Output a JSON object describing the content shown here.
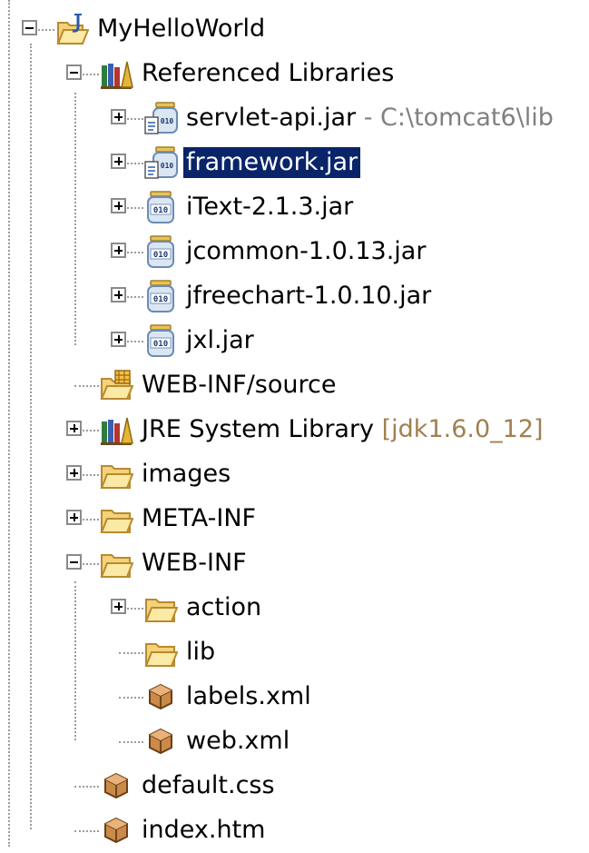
{
  "tree": {
    "items": [
      {
        "id": "project",
        "label": "MyHelloWorld",
        "icon": "java-project-icon",
        "depth": 0,
        "toggle": "minus"
      },
      {
        "id": "ref-libs",
        "label": "Referenced Libraries",
        "icon": "library-icon",
        "depth": 1,
        "toggle": "minus"
      },
      {
        "id": "servlet-api",
        "label": "servlet-api.jar",
        "decoration": " - C:\\tomcat6\\lib",
        "icon": "jar-source-icon",
        "depth": 2,
        "toggle": "plus"
      },
      {
        "id": "framework",
        "label": "framework.jar",
        "icon": "jar-source-icon",
        "depth": 2,
        "toggle": "plus",
        "selected": true
      },
      {
        "id": "itext",
        "label": "iText-2.1.3.jar",
        "icon": "jar-icon",
        "depth": 2,
        "toggle": "plus"
      },
      {
        "id": "jcommon",
        "label": "jcommon-1.0.13.jar",
        "icon": "jar-icon",
        "depth": 2,
        "toggle": "plus"
      },
      {
        "id": "jfreechart",
        "label": "jfreechart-1.0.10.jar",
        "icon": "jar-icon",
        "depth": 2,
        "toggle": "plus"
      },
      {
        "id": "jxl",
        "label": "jxl.jar",
        "icon": "jar-icon",
        "depth": 2,
        "toggle": "plus"
      },
      {
        "id": "webinf-source",
        "label": "WEB-INF/source",
        "icon": "source-folder-icon",
        "depth": 1,
        "toggle": "none"
      },
      {
        "id": "jre",
        "label": "JRE System Library",
        "decoration": " [jdk1.6.0_12]",
        "icon": "library-icon",
        "depth": 1,
        "toggle": "plus"
      },
      {
        "id": "images",
        "label": "images",
        "icon": "folder-icon",
        "depth": 1,
        "toggle": "plus"
      },
      {
        "id": "meta-inf",
        "label": "META-INF",
        "icon": "folder-icon",
        "depth": 1,
        "toggle": "plus"
      },
      {
        "id": "web-inf",
        "label": "WEB-INF",
        "icon": "folder-icon",
        "depth": 1,
        "toggle": "minus"
      },
      {
        "id": "action",
        "label": "action",
        "icon": "folder-icon",
        "depth": 2,
        "toggle": "plus"
      },
      {
        "id": "lib",
        "label": "lib",
        "icon": "folder-icon",
        "depth": 2,
        "toggle": "none"
      },
      {
        "id": "labels-xml",
        "label": "labels.xml",
        "icon": "file-icon",
        "depth": 2,
        "toggle": "none"
      },
      {
        "id": "web-xml",
        "label": "web.xml",
        "icon": "file-icon",
        "depth": 2,
        "toggle": "none"
      },
      {
        "id": "default-css",
        "label": "default.css",
        "icon": "file-icon",
        "depth": 1,
        "toggle": "none"
      },
      {
        "id": "index-htm",
        "label": "index.htm",
        "icon": "file-icon",
        "depth": 1,
        "toggle": "none"
      }
    ]
  },
  "colors": {
    "selection": "#0a246a",
    "decoration_gray": "#808080",
    "decoration_brown": "#a08050",
    "tree_lines": "#9c9c9c"
  }
}
